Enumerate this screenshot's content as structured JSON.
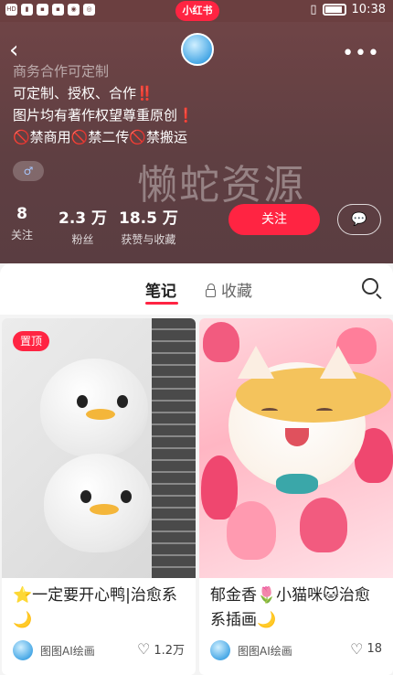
{
  "status_bar": {
    "time": "10:38",
    "app_badge": "小红书"
  },
  "profile": {
    "bio_line0": "商务合作可定制",
    "bio_line1": "可定制、授权、合作‼️",
    "bio_line2": "图片均有著作权望尊重原创❗",
    "bio_line3": "🚫禁商用🚫禁二传🚫禁搬运",
    "gender_symbol": "♂",
    "watermark": "懒蛇资源",
    "stats": [
      {
        "value": "8",
        "label": "关注"
      },
      {
        "value": "2.3 万",
        "label": "粉丝"
      },
      {
        "value": "18.5 万",
        "label": "获赞与收藏"
      }
    ],
    "follow_label": "关注",
    "message_icon": "💬"
  },
  "tabs": {
    "notes": "笔记",
    "collect": "收藏"
  },
  "notes": [
    {
      "badge": "置顶",
      "title": "⭐一定要开心鸭|治愈系🌙",
      "author": "图图AI绘画",
      "likes": "1.2万"
    },
    {
      "title": "郁金香🌷小猫咪🐱治愈系插画🌙",
      "author": "图图AI绘画",
      "likes": "18"
    }
  ],
  "colors": {
    "accent": "#ff2442",
    "hero_bg": "#6a4244"
  }
}
